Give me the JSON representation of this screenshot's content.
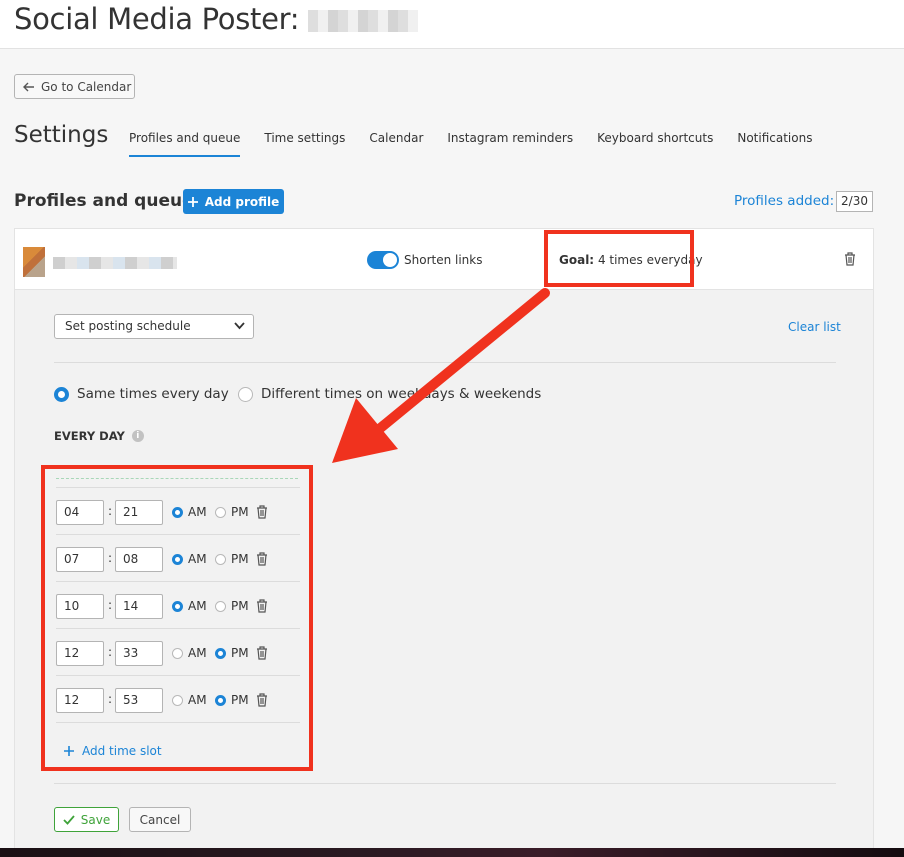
{
  "header": {
    "title": "Social Media Poster:"
  },
  "nav": {
    "back_label": "Go to Calendar"
  },
  "settings": {
    "title": "Settings",
    "tabs": [
      {
        "label": "Profiles and queue",
        "active": true
      },
      {
        "label": "Time settings"
      },
      {
        "label": "Calendar"
      },
      {
        "label": "Instagram reminders"
      },
      {
        "label": "Keyboard shortcuts"
      },
      {
        "label": "Notifications"
      }
    ]
  },
  "profiles": {
    "heading": "Profiles and queue",
    "add_label": "Add profile",
    "added_label": "Profiles added:",
    "added_count": "2/30"
  },
  "profile_row": {
    "shorten_links_label": "Shorten links",
    "shorten_links_on": true,
    "goal_label": "Goal:",
    "goal_value": "4 times everyday"
  },
  "schedule": {
    "select_value": "Set posting schedule",
    "clear_label": "Clear list",
    "option_same": "Same times every day",
    "option_different": "Different times on weekdays & weekends",
    "selected_option": "same",
    "every_day_label": "EVERY DAY",
    "am_label": "AM",
    "pm_label": "PM",
    "slots": [
      {
        "hour": "04",
        "minute": "21",
        "period": "AM"
      },
      {
        "hour": "07",
        "minute": "08",
        "period": "AM"
      },
      {
        "hour": "10",
        "minute": "14",
        "period": "AM"
      },
      {
        "hour": "12",
        "minute": "33",
        "period": "PM"
      },
      {
        "hour": "12",
        "minute": "53",
        "period": "PM"
      }
    ],
    "add_slot_label": "Add time slot"
  },
  "actions": {
    "save_label": "Save",
    "cancel_label": "Cancel"
  },
  "colors": {
    "accent": "#1c84d6",
    "highlight": "#f0321e",
    "save": "#3fa33a"
  },
  "icons": [
    "arrow-left-icon",
    "plus-icon",
    "trash-icon",
    "chevron-down-icon",
    "info-icon",
    "check-icon"
  ]
}
